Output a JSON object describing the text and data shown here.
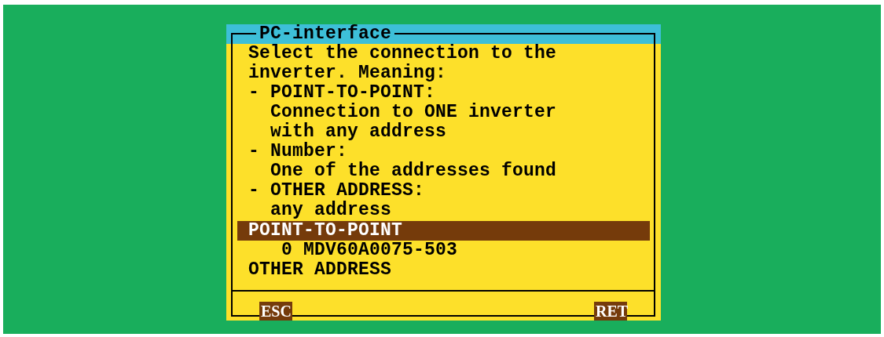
{
  "window": {
    "title": "PC-interface"
  },
  "help_lines": [
    {
      "kind": "text",
      "text": "Select the connection to the"
    },
    {
      "kind": "text",
      "text": "inverter. Meaning:"
    },
    {
      "kind": "bullet",
      "text": "- POINT-TO-POINT:"
    },
    {
      "kind": "detail",
      "text": "Connection to ONE inverter"
    },
    {
      "kind": "detail",
      "text": "with any address"
    },
    {
      "kind": "bullet",
      "text": "- Number:"
    },
    {
      "kind": "detail",
      "text": "One of the addresses found"
    },
    {
      "kind": "bullet",
      "text": "- OTHER ADDRESS:"
    },
    {
      "kind": "detail",
      "text": "any address"
    }
  ],
  "options": [
    {
      "kind": "mode",
      "label": "POINT-TO-POINT",
      "selected": true
    },
    {
      "kind": "address",
      "label": "0 MDV60A0075-503",
      "selected": false
    },
    {
      "kind": "mode",
      "label": "OTHER ADDRESS",
      "selected": false
    }
  ],
  "keys": [
    "ESC",
    "RET"
  ]
}
